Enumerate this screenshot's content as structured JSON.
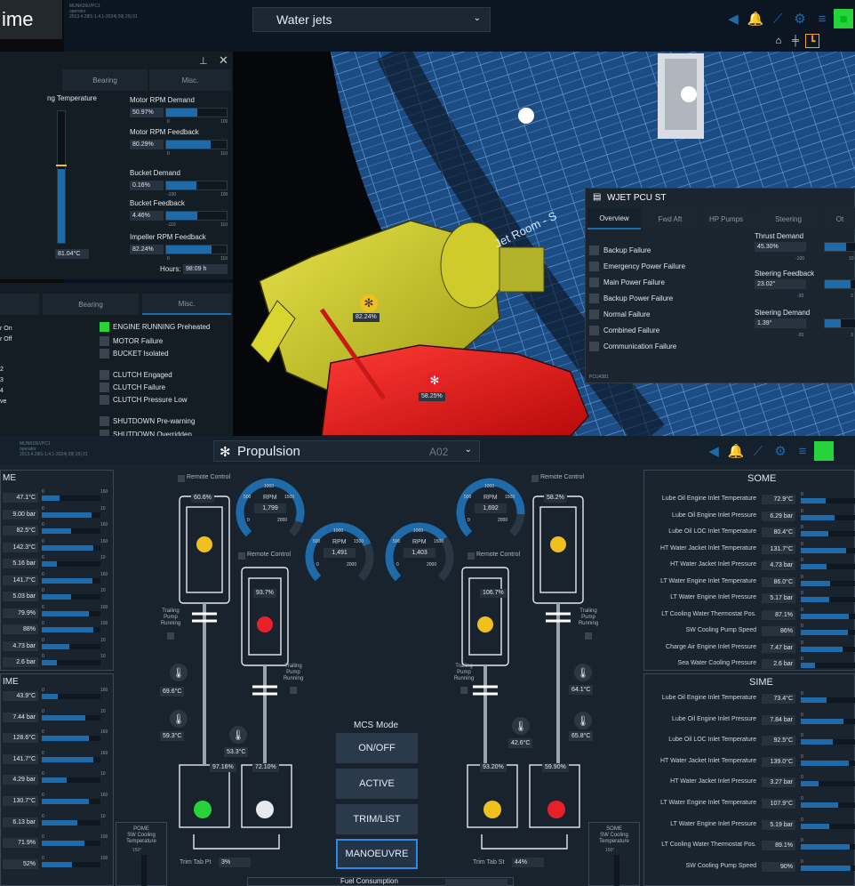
{
  "top": {
    "title_fragment": "ime",
    "side_text": "n-",
    "operator": {
      "machine": "MUNKDEVPC1",
      "role": "operator",
      "build": "2013.4.28f1-1.4.1-2024| 09| 25| 01"
    },
    "view_select": "Water jets",
    "left_panel": {
      "tabs": [
        "Bearing",
        "Misc."
      ],
      "temp_label": "ng Temperature",
      "temp_value": "81.04°C",
      "rows": [
        {
          "label": "Motor RPM Demand",
          "value": "50.97%",
          "min": "0",
          "max": "100",
          "fill": 0.51
        },
        {
          "label": "Motor RPM Feedback",
          "value": "80.29%",
          "min": "0",
          "max": "110",
          "fill": 0.73
        },
        {
          "label": "Bucket Demand",
          "value": "0.16%",
          "min": "-100",
          "max": "100",
          "fill": 0.5
        },
        {
          "label": "Bucket Feedback",
          "value": "4.46%",
          "min": "-110",
          "max": "110",
          "fill": 0.52
        },
        {
          "label": "Impeller RPM Feedback",
          "value": "82.24%",
          "min": "0",
          "max": "110",
          "fill": 0.75
        }
      ],
      "hours_label": "Hours:",
      "hours_value": "98:09 h",
      "tabs2": [
        "Bearing",
        "Misc."
      ],
      "side_items": [
        "r On",
        "r Off",
        "2",
        "3",
        "4",
        "ve"
      ],
      "status": [
        {
          "label": "ENGINE RUNNING Preheated",
          "on": true
        },
        {
          "label": "MOTOR Failure",
          "on": false
        },
        {
          "label": "BUCKET Isolated",
          "on": false
        },
        {
          "label": "CLUTCH Engaged",
          "on": false
        },
        {
          "label": "CLUTCH Failure",
          "on": false
        },
        {
          "label": "CLUTCH Pressure Low",
          "on": false
        },
        {
          "label": "SHUTDOWN Pre-warning",
          "on": false
        },
        {
          "label": "SHUTDOWN Overridden",
          "on": false
        }
      ]
    },
    "scene": {
      "jet_room_label": "Jet Room - S",
      "jet1_pct": "82.24%",
      "jet2_pct": "58.25%"
    },
    "pcu": {
      "title": "WJET PCU ST",
      "tabs": [
        "Overview",
        "Fwd Aft",
        "HP Pumps",
        "Steering",
        "Ot"
      ],
      "failures": [
        "Backup Failure",
        "Emergency Power Failure",
        "Main Power Failure",
        "Backup Power Failure",
        "Normal Failure",
        "Combined Failure",
        "Communication Failure"
      ],
      "thrust": {
        "label": "Thrust Demand",
        "value": "45.30%",
        "min": "-100",
        "max": "10",
        "fill": 0.72
      },
      "steer_fb": {
        "label": "Steering Feedback",
        "value": "23.02°",
        "min": "-30",
        "max": "3",
        "fill": 0.85
      },
      "steer_dem": {
        "label": "Steering Demand",
        "value": "1.39°",
        "min": "-30",
        "max": "3",
        "fill": 0.52
      },
      "footer": "PCU4381"
    }
  },
  "bottom": {
    "operator": {
      "machine": "MUNKDEVPC1",
      "role": "operator",
      "build": "2013.4.28f1-1.4.1-2024| 09| 25| 01"
    },
    "title": "Propulsion",
    "zone": "A02",
    "left_me": {
      "title": "ME",
      "values": [
        "47.1°C",
        "9.00 bar",
        "82.5°C",
        "142.3°C",
        "5.16 bar",
        "141.7°C",
        "5.03 bar",
        "79.9%",
        "88%",
        "4.73 bar",
        "2.6 bar"
      ],
      "maxes": [
        "160",
        "10",
        "160",
        "160",
        "10",
        "160",
        "10",
        "100",
        "100",
        "10",
        "10"
      ],
      "fills": [
        0.3,
        0.85,
        0.5,
        0.88,
        0.25,
        0.87,
        0.5,
        0.8,
        0.88,
        0.47,
        0.26
      ]
    },
    "left_ime": {
      "title": "IME",
      "values": [
        "43.9°C",
        "7.44 bar",
        "128.6°C",
        "141.7°C",
        "4.29 bar",
        "130.7°C",
        "6.13 bar",
        "71.9%",
        "52%"
      ],
      "maxes": [
        "160",
        "10",
        "160",
        "160",
        "10",
        "160",
        "10",
        "100",
        "100"
      ],
      "fills": [
        0.27,
        0.74,
        0.8,
        0.88,
        0.43,
        0.81,
        0.61,
        0.72,
        0.52
      ]
    },
    "some": {
      "title": "SOME",
      "rows": [
        {
          "label": "Lube Oil Engine Inlet Temperature",
          "value": "72.9°C",
          "fill": 0.45
        },
        {
          "label": "Lube Oil Engine Inlet Pressure",
          "value": "6.29 bar",
          "fill": 0.62
        },
        {
          "label": "Lube Oil LOC Inlet Temperature",
          "value": "80.4°C",
          "fill": 0.5
        },
        {
          "label": "HT Water Jacket Inlet Temperature",
          "value": "131.7°C",
          "fill": 0.82
        },
        {
          "label": "HT Water Jacket Inlet Pressure",
          "value": "4.73 bar",
          "fill": 0.47
        },
        {
          "label": "LT Water Engine Inlet Temperature",
          "value": "86.0°C",
          "fill": 0.54
        },
        {
          "label": "LT Water Engine Inlet Pressure",
          "value": "5.17 bar",
          "fill": 0.52
        },
        {
          "label": "LT Cooling Water Thermostat Pos.",
          "value": "87.1%",
          "fill": 0.87
        },
        {
          "label": "SW Cooling Pump Speed",
          "value": "86%",
          "fill": 0.86
        },
        {
          "label": "Charge Air Engine Inlet Pressure",
          "value": "7.47 bar",
          "fill": 0.75
        },
        {
          "label": "Sea Water Cooling Pressure",
          "value": "2.6 bar",
          "fill": 0.26
        }
      ]
    },
    "sime": {
      "title": "SIME",
      "rows": [
        {
          "label": "Lube Oil Engine Inlet Temperature",
          "value": "73.4°C",
          "fill": 0.46
        },
        {
          "label": "Lube Oil Engine Inlet Pressure",
          "value": "7.84 bar",
          "fill": 0.78
        },
        {
          "label": "Lube Oil LOC Inlet Temperature",
          "value": "92.5°C",
          "fill": 0.58
        },
        {
          "label": "HT Water Jacket Inlet Temperature",
          "value": "139.0°C",
          "fill": 0.87
        },
        {
          "label": "HT Water Jacket Inlet Pressure",
          "value": "3.27 bar",
          "fill": 0.33
        },
        {
          "label": "LT Water Engine Inlet Temperature",
          "value": "107.9°C",
          "fill": 0.67
        },
        {
          "label": "LT Water Engine Inlet Pressure",
          "value": "5.19 bar",
          "fill": 0.52
        },
        {
          "label": "LT Cooling Water Thermostat Pos.",
          "value": "89.1%",
          "fill": 0.89
        },
        {
          "label": "SW Cooling Pump Speed",
          "value": "90%",
          "fill": 0.9
        }
      ]
    },
    "remote_control": "Remote Control",
    "gauges": [
      {
        "rpm": "1,799",
        "fill": 0.9
      },
      {
        "rpm": "1,491",
        "fill": 0.745
      },
      {
        "rpm": "1,403",
        "fill": 0.7
      },
      {
        "rpm": "1,692",
        "fill": 0.846
      }
    ],
    "gauge_labels": {
      "unit": "RPM",
      "t500": "500",
      "t1000": "1000",
      "t1500": "1500",
      "t0": "0",
      "t2000": "2000"
    },
    "engine_pcts": [
      "60.6%",
      "93.7%",
      "106.7%",
      "58.2%"
    ],
    "temps": [
      "69.6°C",
      "59.3°C",
      "53.3°C",
      "42.6°C",
      "64.1°C",
      "65.8°C"
    ],
    "trailing": "Trailing\nPump\nRunning",
    "jet_pcts": [
      "97.16%",
      "72.10%",
      "93.20%",
      "59.90%"
    ],
    "mcs_title": "MCS Mode",
    "mcs": [
      "ON/OFF",
      "ACTIVE",
      "TRIM/LIST",
      "MANOEUVRE"
    ],
    "trim_pt_label": "Trim Tab Pt",
    "trim_pt": "3%",
    "trim_st_label": "Trim Tab St",
    "trim_st": "44%",
    "pome_cool": "POME\nSW Cooling\nTemperature",
    "some_cool": "SOME\nSW Cooling\nTemperature",
    "cool_max": "150°",
    "fuel": "Fuel Consumption"
  },
  "colors": {
    "accent": "#1f6aa8",
    "green": "#27d23a",
    "alarm_red": "#e8202a",
    "yellow": "#f0c020"
  }
}
